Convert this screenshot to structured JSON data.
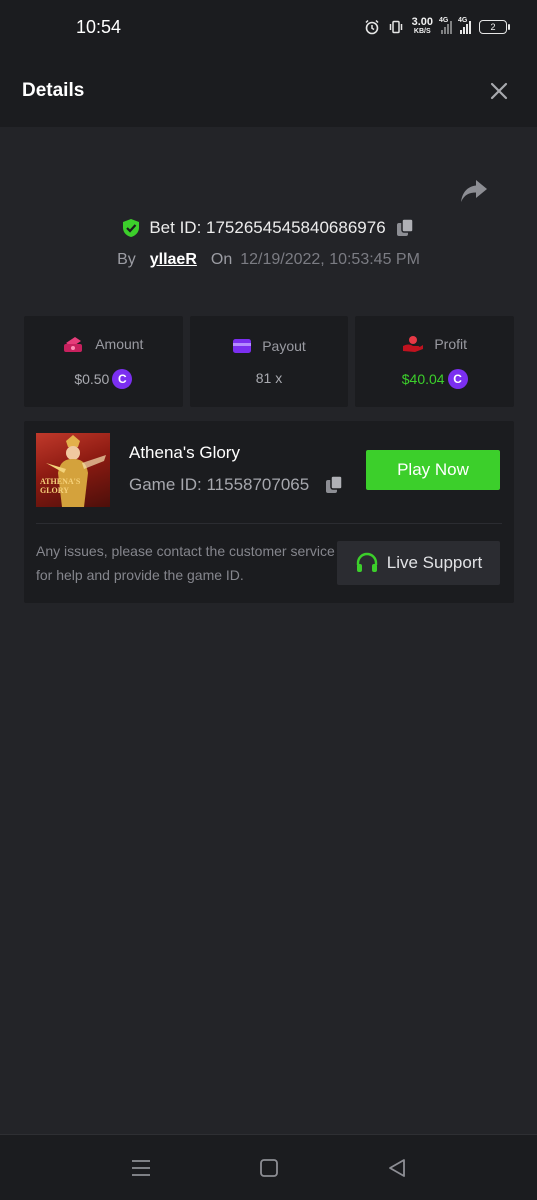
{
  "status_bar": {
    "time": "10:54",
    "net_speed_value": "3.00",
    "net_speed_unit": "KB/S",
    "network_1": "4G",
    "network_2": "4G",
    "battery": "2"
  },
  "header": {
    "title": "Details"
  },
  "bet": {
    "id_label": "Bet ID: 1752654545840686976",
    "by_label": "By",
    "username": "yllaeR",
    "on_label": "On",
    "datetime": "12/19/2022, 10:53:45 PM"
  },
  "stats": {
    "amount": {
      "label": "Amount",
      "value": "$0.50",
      "icon": "cash-icon"
    },
    "payout": {
      "label": "Payout",
      "value": "81 x",
      "icon": "card-icon"
    },
    "profit": {
      "label": "Profit",
      "value": "$40.04",
      "icon": "hand-coin-icon"
    },
    "coin_glyph": "C"
  },
  "game": {
    "thumbnail_text_1": "ATHENA'S",
    "thumbnail_text_2": "GLORY",
    "name": "Athena's Glory",
    "id_label": "Game ID: 11558707065",
    "play_label": "Play Now",
    "support_text": "Any issues, please contact the customer service for help and provide the game ID.",
    "support_label": "Live Support"
  },
  "colors": {
    "accent_green": "#3ccf2b",
    "coin_purple": "#7b2ff0",
    "background": "#232428",
    "panel": "#1b1c1f"
  }
}
